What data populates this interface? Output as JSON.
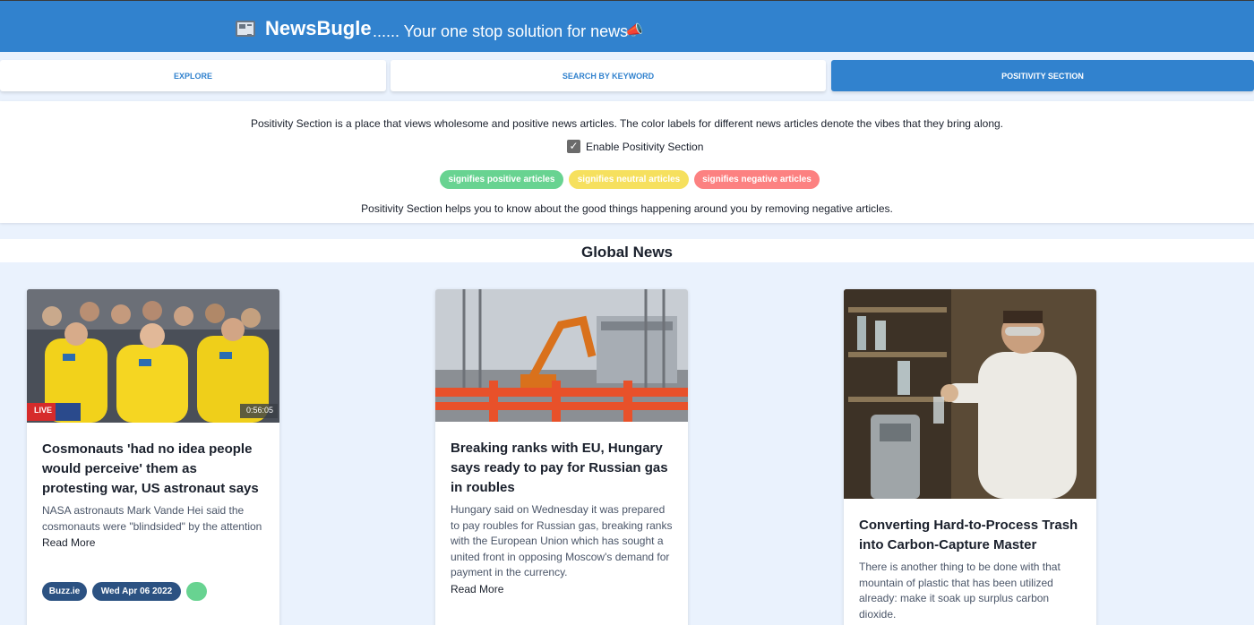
{
  "header": {
    "brand": "NewsBugle",
    "tagline": "...... Your one stop solution for news"
  },
  "tabs": [
    {
      "label": "EXPLORE",
      "active": false
    },
    {
      "label": "SEARCH BY KEYWORD",
      "active": false
    },
    {
      "label": "POSITIVITY SECTION",
      "active": true
    }
  ],
  "positivity": {
    "description": "Positivity Section is a place that views wholesome and positive news articles. The color labels for different news articles denote the vibes that they bring along.",
    "checkbox_label": "Enable Positivity Section",
    "checkbox_checked": true,
    "legend": [
      {
        "label": "signifies positive articles",
        "color": "#68d391"
      },
      {
        "label": "signifies neutral articles",
        "color": "#f6e05e"
      },
      {
        "label": "signifies negative articles",
        "color": "#fc8181"
      }
    ],
    "footer": "Positivity Section helps you to know about the good things happening around you by removing negative articles."
  },
  "section_title": "Global News",
  "articles": [
    {
      "title": "Cosmonauts 'had no idea people would perceive' them as protesting war, US astronaut says",
      "description": "NASA astronauts Mark Vande Hei said the cosmonauts were \"blindsided\" by the attention",
      "read_more": "Read More",
      "source": "Buzz.ie",
      "date": "Wed Apr 06 2022",
      "vibe": "positive",
      "image_overlay": {
        "live": "LIVE",
        "time": "0:56:05"
      }
    },
    {
      "title": "Breaking ranks with EU, Hungary says ready to pay for Russian gas in roubles",
      "description": "Hungary said on Wednesday it was prepared to pay roubles for Russian gas, breaking ranks with the European Union which has sought a united front in opposing Moscow's demand for payment in the currency.",
      "read_more": "Read More"
    },
    {
      "title": "Converting Hard-to-Process Trash into Carbon-Capture Master",
      "description": "There is another thing to be done with that mountain of plastic that has been utilized already: make it soak up surplus carbon dioxide."
    }
  ],
  "colors": {
    "primary": "#3182ce",
    "badge": "#2c5282",
    "positive": "#68d391",
    "neutral": "#f6e05e",
    "negative": "#fc8181"
  }
}
